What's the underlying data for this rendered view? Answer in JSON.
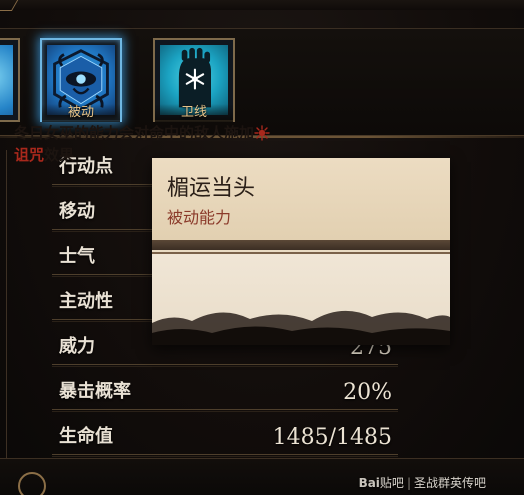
{
  "skills": {
    "passive_label": "被动",
    "guard_label": "卫线"
  },
  "stats": [
    {
      "label": "行动点",
      "value": ""
    },
    {
      "label": "移动",
      "value": ""
    },
    {
      "label": "士气",
      "value": ""
    },
    {
      "label": "主动性",
      "value": ""
    },
    {
      "label": "威力",
      "value": "275"
    },
    {
      "label": "暴击概率",
      "value": "20%"
    },
    {
      "label": "生命值",
      "value": "1485/1485"
    }
  ],
  "tooltip": {
    "title": "楣运当头",
    "subtitle": "被动能力",
    "text_before": "冬日女巫的能力会对命中的敌人施加",
    "curse_word": "诅咒",
    "text_after": "效果",
    "curse_icon": "curse-icon",
    "curse_color": "#a8281c"
  },
  "watermark": {
    "logo": "Bai",
    "logo_suffix": "贴吧",
    "separator": "|",
    "forum": "圣战群英传吧"
  },
  "colors": {
    "passive_glow": "#6fb7e2",
    "stat_text": "#e9e1d4",
    "card_label": "#e8c489"
  }
}
